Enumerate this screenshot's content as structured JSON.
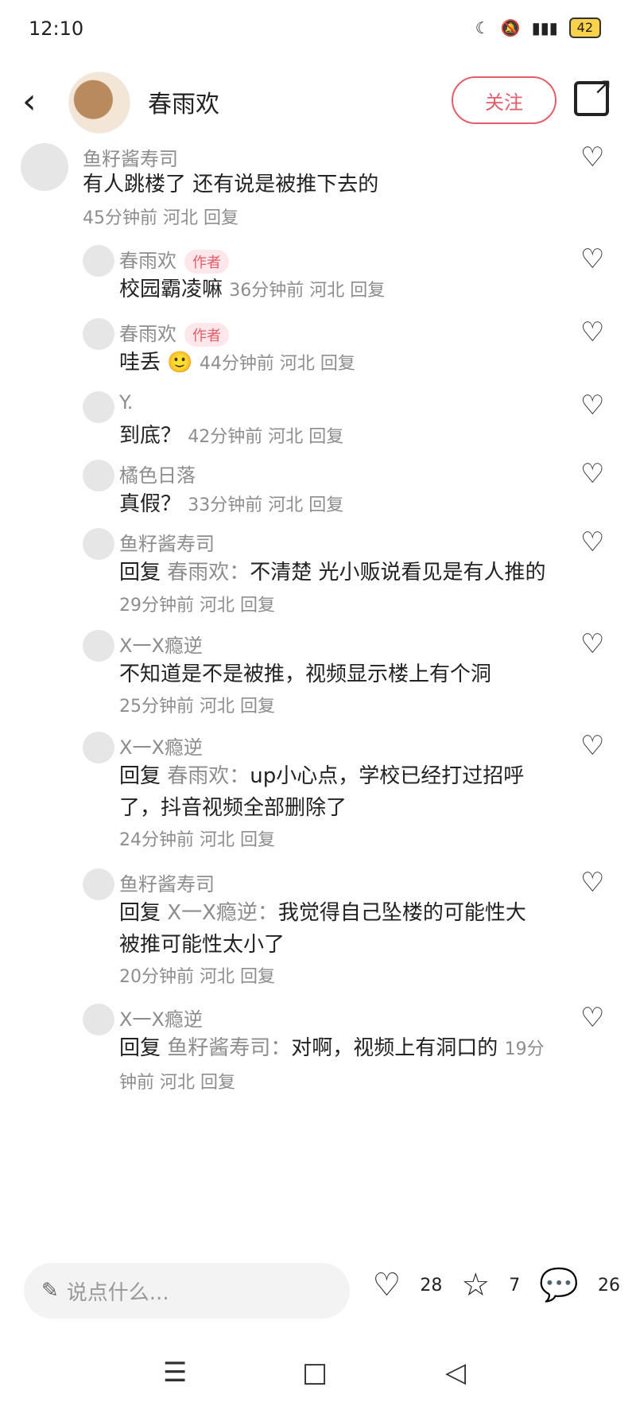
{
  "status_bar": {
    "time": "12:10",
    "battery": "42"
  },
  "header": {
    "author": "春雨欢",
    "follow_label": "关注"
  },
  "comments": [
    {
      "user": "鱼籽酱寿司",
      "text": "有人跳楼了 还有说是被推下去的",
      "meta": "45分钟前  河北  回复"
    },
    {
      "user": "春雨欢",
      "badge": "作者",
      "text": "校园霸凌嘛",
      "meta": "36分钟前  河北  回复"
    },
    {
      "user": "春雨欢",
      "badge": "作者",
      "text": "哇丢 🙂",
      "meta": "44分钟前  河北  回复"
    },
    {
      "user": "Y.",
      "text": "到底？",
      "meta": "42分钟前  河北  回复"
    },
    {
      "user": "橘色日落",
      "text": "真假？",
      "meta": "33分钟前  河北  回复"
    },
    {
      "user": "鱼籽酱寿司",
      "reply_prefix": "回复",
      "reply_to": "春雨欢：",
      "text": "不清楚 光小贩说看见是有人推的",
      "meta": "29分钟前  河北  回复"
    },
    {
      "user": "X一X瘾逆",
      "text": "不知道是不是被推，视频显示楼上有个洞",
      "meta": "25分钟前  河北  回复"
    },
    {
      "user": "X一X瘾逆",
      "reply_prefix": "回复",
      "reply_to": "春雨欢：",
      "text": "up小心点，学校已经打过招呼了，抖音视频全部删除了",
      "meta": "24分钟前  河北  回复"
    },
    {
      "user": "鱼籽酱寿司",
      "reply_prefix": "回复",
      "reply_to": "X一X瘾逆：",
      "text": "我觉得自己坠楼的可能性大 被推可能性太小了",
      "meta": "20分钟前  河北  回复"
    },
    {
      "user": "X一X瘾逆",
      "reply_prefix": "回复",
      "reply_to": "鱼籽酱寿司：",
      "text": "对啊，视频上有洞口的",
      "meta": "19分钟前  河北  回复"
    }
  ],
  "bottom": {
    "placeholder": "说点什么...",
    "likes": "28",
    "stars": "7",
    "comments": "26"
  }
}
